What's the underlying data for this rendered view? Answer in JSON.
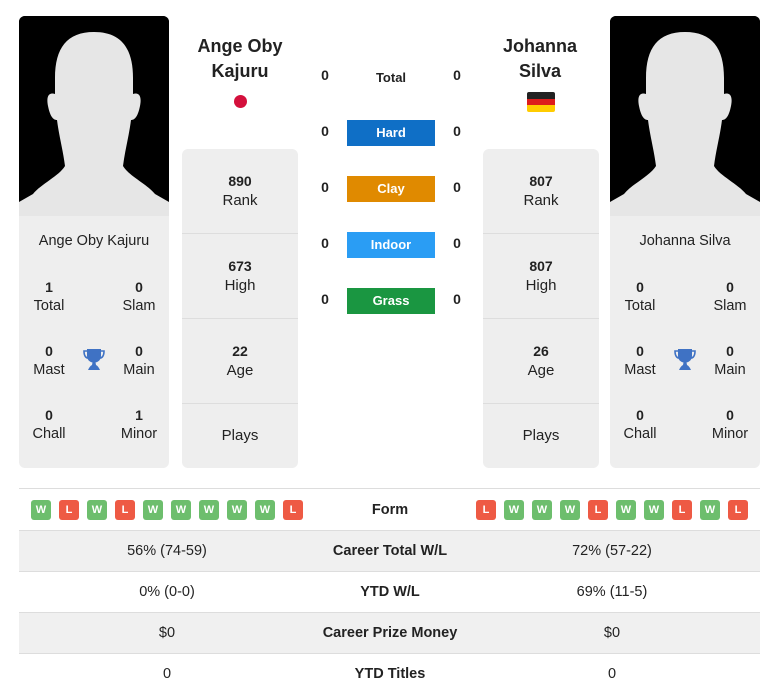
{
  "colors": {
    "hard": "#0f6fc6",
    "clay": "#e08a00",
    "indoor": "#2a9df4",
    "grass": "#1a9641",
    "win": "#6dbe6d",
    "loss": "#ee5a44",
    "trophy": "#3f72c4"
  },
  "player1": {
    "name": "Ange Oby Kajuru",
    "heading_line1": "Ange Oby",
    "heading_line2": "Kajuru",
    "flag": "japan-flag",
    "titles": {
      "total": {
        "value": "1",
        "label": "Total"
      },
      "slam": {
        "value": "0",
        "label": "Slam"
      },
      "mast": {
        "value": "0",
        "label": "Mast"
      },
      "main": {
        "value": "0",
        "label": "Main"
      },
      "chall": {
        "value": "0",
        "label": "Chall"
      },
      "minor": {
        "value": "1",
        "label": "Minor"
      }
    },
    "stats": {
      "rank": {
        "value": "890",
        "label": "Rank"
      },
      "high": {
        "value": "673",
        "label": "High"
      },
      "age": {
        "value": "22",
        "label": "Age"
      },
      "plays": {
        "value": "",
        "label": "Plays"
      }
    },
    "form": [
      "W",
      "L",
      "W",
      "L",
      "W",
      "W",
      "W",
      "W",
      "W",
      "L"
    ],
    "career_total_wl": "56% (74-59)",
    "ytd_wl": "0% (0-0)",
    "career_prize_money": "$0",
    "ytd_titles": "0"
  },
  "player2": {
    "name": "Johanna Silva",
    "heading_line1": "Johanna",
    "heading_line2": "Silva",
    "flag": "germany-flag",
    "titles": {
      "total": {
        "value": "0",
        "label": "Total"
      },
      "slam": {
        "value": "0",
        "label": "Slam"
      },
      "mast": {
        "value": "0",
        "label": "Mast"
      },
      "main": {
        "value": "0",
        "label": "Main"
      },
      "chall": {
        "value": "0",
        "label": "Chall"
      },
      "minor": {
        "value": "0",
        "label": "Minor"
      }
    },
    "stats": {
      "rank": {
        "value": "807",
        "label": "Rank"
      },
      "high": {
        "value": "807",
        "label": "High"
      },
      "age": {
        "value": "26",
        "label": "Age"
      },
      "plays": {
        "value": "",
        "label": "Plays"
      }
    },
    "form": [
      "L",
      "W",
      "W",
      "W",
      "L",
      "W",
      "W",
      "L",
      "W",
      "L"
    ],
    "career_total_wl": "72% (57-22)",
    "ytd_wl": "69% (11-5)",
    "career_prize_money": "$0",
    "ytd_titles": "0"
  },
  "h2h": {
    "rows": [
      {
        "label": "Total",
        "p1": "0",
        "p2": "0"
      },
      {
        "label": "Hard",
        "p1": "0",
        "p2": "0"
      },
      {
        "label": "Clay",
        "p1": "0",
        "p2": "0"
      },
      {
        "label": "Indoor",
        "p1": "0",
        "p2": "0"
      },
      {
        "label": "Grass",
        "p1": "0",
        "p2": "0"
      }
    ]
  },
  "comparison": {
    "form_label": "Form",
    "career_total_wl_label": "Career Total W/L",
    "ytd_wl_label": "YTD W/L",
    "career_prize_money_label": "Career Prize Money",
    "ytd_titles_label": "YTD Titles"
  }
}
